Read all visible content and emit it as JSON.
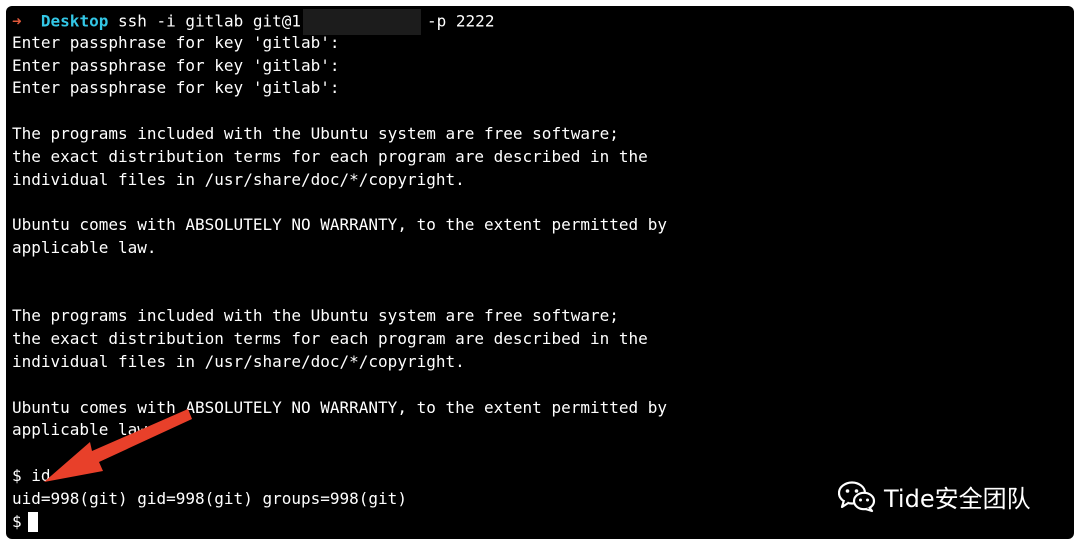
{
  "terminal": {
    "prompt_arrow": "➜",
    "cwd": "Desktop",
    "command_start": "ssh -i gitlab git@1",
    "command_end": "-p 2222",
    "lines": [
      "Enter passphrase for key 'gitlab':",
      "Enter passphrase for key 'gitlab':",
      "Enter passphrase for key 'gitlab':",
      "",
      "The programs included with the Ubuntu system are free software;",
      "the exact distribution terms for each program are described in the",
      "individual files in /usr/share/doc/*/copyright.",
      "",
      "Ubuntu comes with ABSOLUTELY NO WARRANTY, to the extent permitted by",
      "applicable law.",
      "",
      "",
      "The programs included with the Ubuntu system are free software;",
      "the exact distribution terms for each program are described in the",
      "individual files in /usr/share/doc/*/copyright.",
      "",
      "Ubuntu comes with ABSOLUTELY NO WARRANTY, to the extent permitted by",
      "applicable law.",
      "",
      "$ id",
      "uid=998(git) gid=998(git) groups=998(git)"
    ],
    "final_prompt": "$"
  },
  "watermark": {
    "text": "Tide安全团队",
    "icon": "wechat-icon"
  },
  "colors": {
    "background": "#000000",
    "text": "#ffffff",
    "cwd": "#33c7e6",
    "prompt_arrow": "#e0583a",
    "annotation_arrow": "#e8402a"
  }
}
